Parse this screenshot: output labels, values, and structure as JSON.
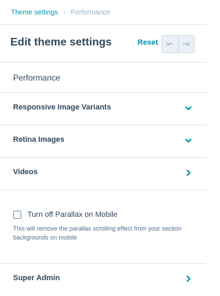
{
  "breadcrumb": {
    "parent": "Theme settings",
    "separator": "›",
    "current": "Performance"
  },
  "header": {
    "title": "Edit theme settings",
    "reset_label": "Reset",
    "undo_icon": "undo-icon",
    "redo_icon": "redo-icon"
  },
  "section": {
    "title": "Performance"
  },
  "rows": [
    {
      "label": "Responsive Image Variants",
      "icon": "chevron-down-icon"
    },
    {
      "label": "Retina Images",
      "icon": "chevron-down-icon"
    },
    {
      "label": "Videos",
      "icon": "chevron-right-icon"
    }
  ],
  "parallax": {
    "checkbox_label": "Turn off Parallax on Mobile",
    "checked": false,
    "help_text": "This will remove the parallax scrolling effect from your section backgrounds on mobile"
  },
  "super_admin": {
    "label": "Super Admin",
    "icon": "chevron-right-icon"
  },
  "colors": {
    "accent": "#0091ae",
    "text": "#33475b",
    "divider": "#dfe3eb",
    "muted": "#99acc2"
  }
}
